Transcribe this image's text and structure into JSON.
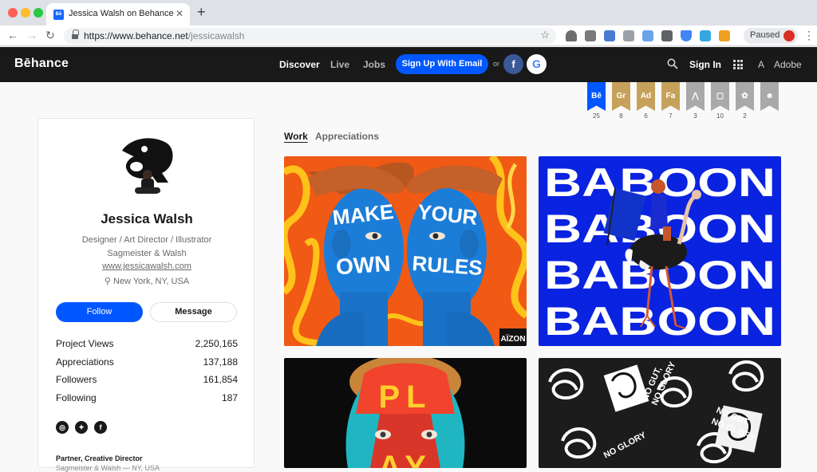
{
  "browser": {
    "tab_title": "Jessica Walsh on Behance",
    "favicon_text": "Bē",
    "url_host": "https://www.behance.net",
    "url_path": "/jessicawalsh",
    "profile_status": "Paused"
  },
  "nav": {
    "logo": "Bēhance",
    "links": [
      "Discover",
      "Live",
      "Jobs"
    ],
    "signup_label": "Sign Up With Email",
    "or_label": "or",
    "facebook_glyph": "f",
    "google_glyph": "G",
    "signin_label": "Sign In",
    "adobe_label": "Adobe",
    "adobe_glyph": "A"
  },
  "badges": [
    {
      "label": "Bē",
      "count": "25",
      "color": "#0057ff"
    },
    {
      "label": "Gr",
      "count": "8",
      "color": "#c6a15b"
    },
    {
      "label": "Ad",
      "count": "6",
      "color": "#c6a15b"
    },
    {
      "label": "Fa",
      "count": "7",
      "color": "#c6a15b"
    },
    {
      "label": "⋀",
      "count": "3",
      "color": "#a9a9a9"
    },
    {
      "label": "▢",
      "count": "10",
      "color": "#a9a9a9"
    },
    {
      "label": "✿",
      "count": "2",
      "color": "#a9a9a9"
    },
    {
      "label": "☻",
      "count": "",
      "color": "#a9a9a9"
    }
  ],
  "profile": {
    "name": "Jessica Walsh",
    "title": "Designer / Art Director / Illustrator",
    "company": "Sagmeister & Walsh",
    "website": "www.jessicawalsh.com",
    "location": "New York, NY, USA",
    "follow_label": "Follow",
    "message_label": "Message",
    "stats": [
      {
        "label": "Project Views",
        "value": "2,250,165"
      },
      {
        "label": "Appreciations",
        "value": "137,188"
      },
      {
        "label": "Followers",
        "value": "161,854"
      },
      {
        "label": "Following",
        "value": "187"
      }
    ],
    "social_icons": [
      "instagram-icon",
      "twitter-icon",
      "facebook-icon"
    ],
    "role": "Partner, Creative Director",
    "role_company": "Sagmeister & Walsh — NY, USA"
  },
  "tabs": [
    "Work",
    "Appreciations"
  ],
  "projects": [
    {
      "title": "MAKE YOUR OWN RULES",
      "words": [
        "MAKE",
        "OWN",
        "YOUR",
        "RULES"
      ],
      "tag": "AÏZON"
    },
    {
      "title": "BABOON",
      "rows": [
        "BABOON",
        "BABOON",
        "BABOON",
        "BABOON"
      ]
    },
    {
      "title": "PLAY",
      "letters": [
        "PL",
        "AY"
      ]
    },
    {
      "title": "NO GUT, NO GLORY",
      "slogan": [
        "NO GUT,",
        "NO GLORY"
      ]
    }
  ],
  "colors": {
    "brand_blue": "#0057ff",
    "nav_bg": "#191919",
    "facebook": "#3b5998"
  }
}
